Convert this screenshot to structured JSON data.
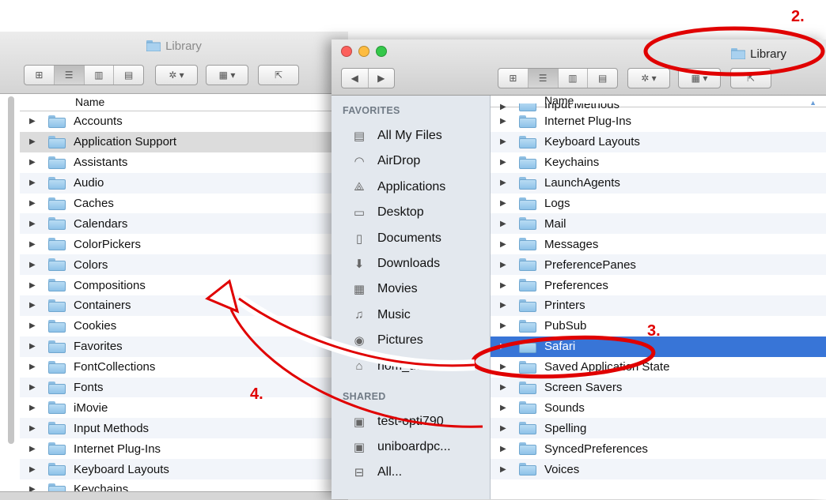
{
  "left_window": {
    "title": "Library",
    "column_name": "Name",
    "rows": [
      "Accounts",
      "Application Support",
      "Assistants",
      "Audio",
      "Caches",
      "Calendars",
      "ColorPickers",
      "Colors",
      "Compositions",
      "Containers",
      "Cookies",
      "Favorites",
      "FontCollections",
      "Fonts",
      "iMovie",
      "Input Methods",
      "Internet Plug-Ins",
      "Keyboard Layouts",
      "Keychains"
    ],
    "highlighted_row": "Application Support"
  },
  "right_window": {
    "title": "Library",
    "column_name": "Name",
    "partial_top_row": "Input Methods",
    "rows": [
      "Internet Plug-Ins",
      "Keyboard Layouts",
      "Keychains",
      "LaunchAgents",
      "Logs",
      "Mail",
      "Messages",
      "PreferencePanes",
      "Preferences",
      "Printers",
      "PubSub",
      "Safari",
      "Saved Application State",
      "Screen Savers",
      "Sounds",
      "Spelling",
      "SyncedPreferences",
      "Voices"
    ],
    "selected_row": "Safari"
  },
  "sidebar": {
    "favorites_header": "FAVORITES",
    "favorites": [
      {
        "label": "All My Files",
        "icon": "all-files-icon"
      },
      {
        "label": "AirDrop",
        "icon": "airdrop-icon"
      },
      {
        "label": "Applications",
        "icon": "applications-icon"
      },
      {
        "label": "Desktop",
        "icon": "desktop-icon"
      },
      {
        "label": "Documents",
        "icon": "documents-icon"
      },
      {
        "label": "Downloads",
        "icon": "downloads-icon"
      },
      {
        "label": "Movies",
        "icon": "movies-icon"
      },
      {
        "label": "Music",
        "icon": "music-icon"
      },
      {
        "label": "Pictures",
        "icon": "pictures-icon"
      },
      {
        "label": "nom_utilisa...",
        "icon": "home-icon"
      }
    ],
    "shared_header": "SHARED",
    "shared": [
      {
        "label": "test-opti790",
        "icon": "computer-icon"
      },
      {
        "label": "uniboardpc...",
        "icon": "computer-icon"
      },
      {
        "label": "All...",
        "icon": "network-icon"
      }
    ]
  },
  "annotations": {
    "step2": "2.",
    "step3": "3.",
    "step4": "4.",
    "color": "#e00000"
  },
  "colors": {
    "selection": "#3875d7",
    "highlight": "#dcdcdc",
    "sidebar_bg": "#e3e8ee"
  }
}
